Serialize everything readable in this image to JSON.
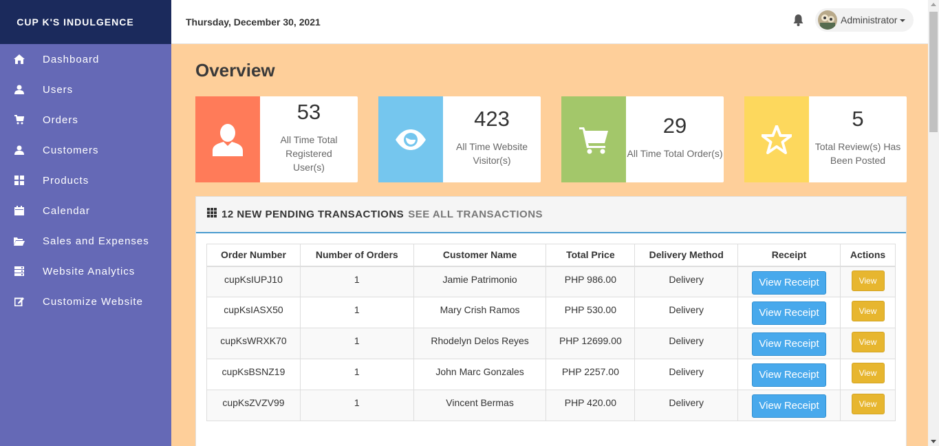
{
  "brand": "CUP K'S INDULGENCE",
  "sidebar": {
    "items": [
      {
        "label": "Dashboard",
        "icon": "home-icon"
      },
      {
        "label": "Users",
        "icon": "user-icon"
      },
      {
        "label": "Orders",
        "icon": "cart-icon"
      },
      {
        "label": "Customers",
        "icon": "user-icon"
      },
      {
        "label": "Products",
        "icon": "grid-icon"
      },
      {
        "label": "Calendar",
        "icon": "calendar-icon"
      },
      {
        "label": "Sales and Expenses",
        "icon": "folder-open-icon"
      },
      {
        "label": "Website Analytics",
        "icon": "server-icon"
      },
      {
        "label": "Customize Website",
        "icon": "edit-icon"
      }
    ]
  },
  "topbar": {
    "date": "Thursday, December 30, 2021",
    "user": "Administrator"
  },
  "page": {
    "title": "Overview"
  },
  "cards": [
    {
      "value": "53",
      "label": "All Time Total Registered User(s)",
      "color": "#ff7b59",
      "icon": "user-icon"
    },
    {
      "value": "423",
      "label": "All Time Website Visitor(s)",
      "color": "#75c6ee",
      "icon": "eye-icon"
    },
    {
      "value": "29",
      "label": "All Time Total Order(s)",
      "color": "#a3c76a",
      "icon": "cart-icon"
    },
    {
      "value": "5",
      "label": "Total Review(s) Has Been Posted",
      "color": "#fdd85d",
      "icon": "star-icon"
    }
  ],
  "panel": {
    "title": "12 NEW PENDING TRANSACTIONS",
    "link": "SEE ALL TRANSACTIONS"
  },
  "table": {
    "headers": [
      "Order Number",
      "Number of Orders",
      "Customer Name",
      "Total Price",
      "Delivery Method",
      "Receipt",
      "Actions"
    ],
    "receipt_label": "View Receipt",
    "view_label": "View",
    "rows": [
      {
        "order": "cupKsIUPJ10",
        "qty": "1",
        "customer": "Jamie Patrimonio",
        "price": "PHP 986.00",
        "method": "Delivery"
      },
      {
        "order": "cupKsIASX50",
        "qty": "1",
        "customer": "Mary Crish Ramos",
        "price": "PHP 530.00",
        "method": "Delivery"
      },
      {
        "order": "cupKsWRXK70",
        "qty": "1",
        "customer": "Rhodelyn Delos Reyes",
        "price": "PHP 12699.00",
        "method": "Delivery"
      },
      {
        "order": "cupKsBSNZ19",
        "qty": "1",
        "customer": "John Marc Gonzales",
        "price": "PHP 2257.00",
        "method": "Delivery"
      },
      {
        "order": "cupKsZVZV99",
        "qty": "1",
        "customer": "Vincent Bermas",
        "price": "PHP 420.00",
        "method": "Delivery"
      }
    ]
  }
}
